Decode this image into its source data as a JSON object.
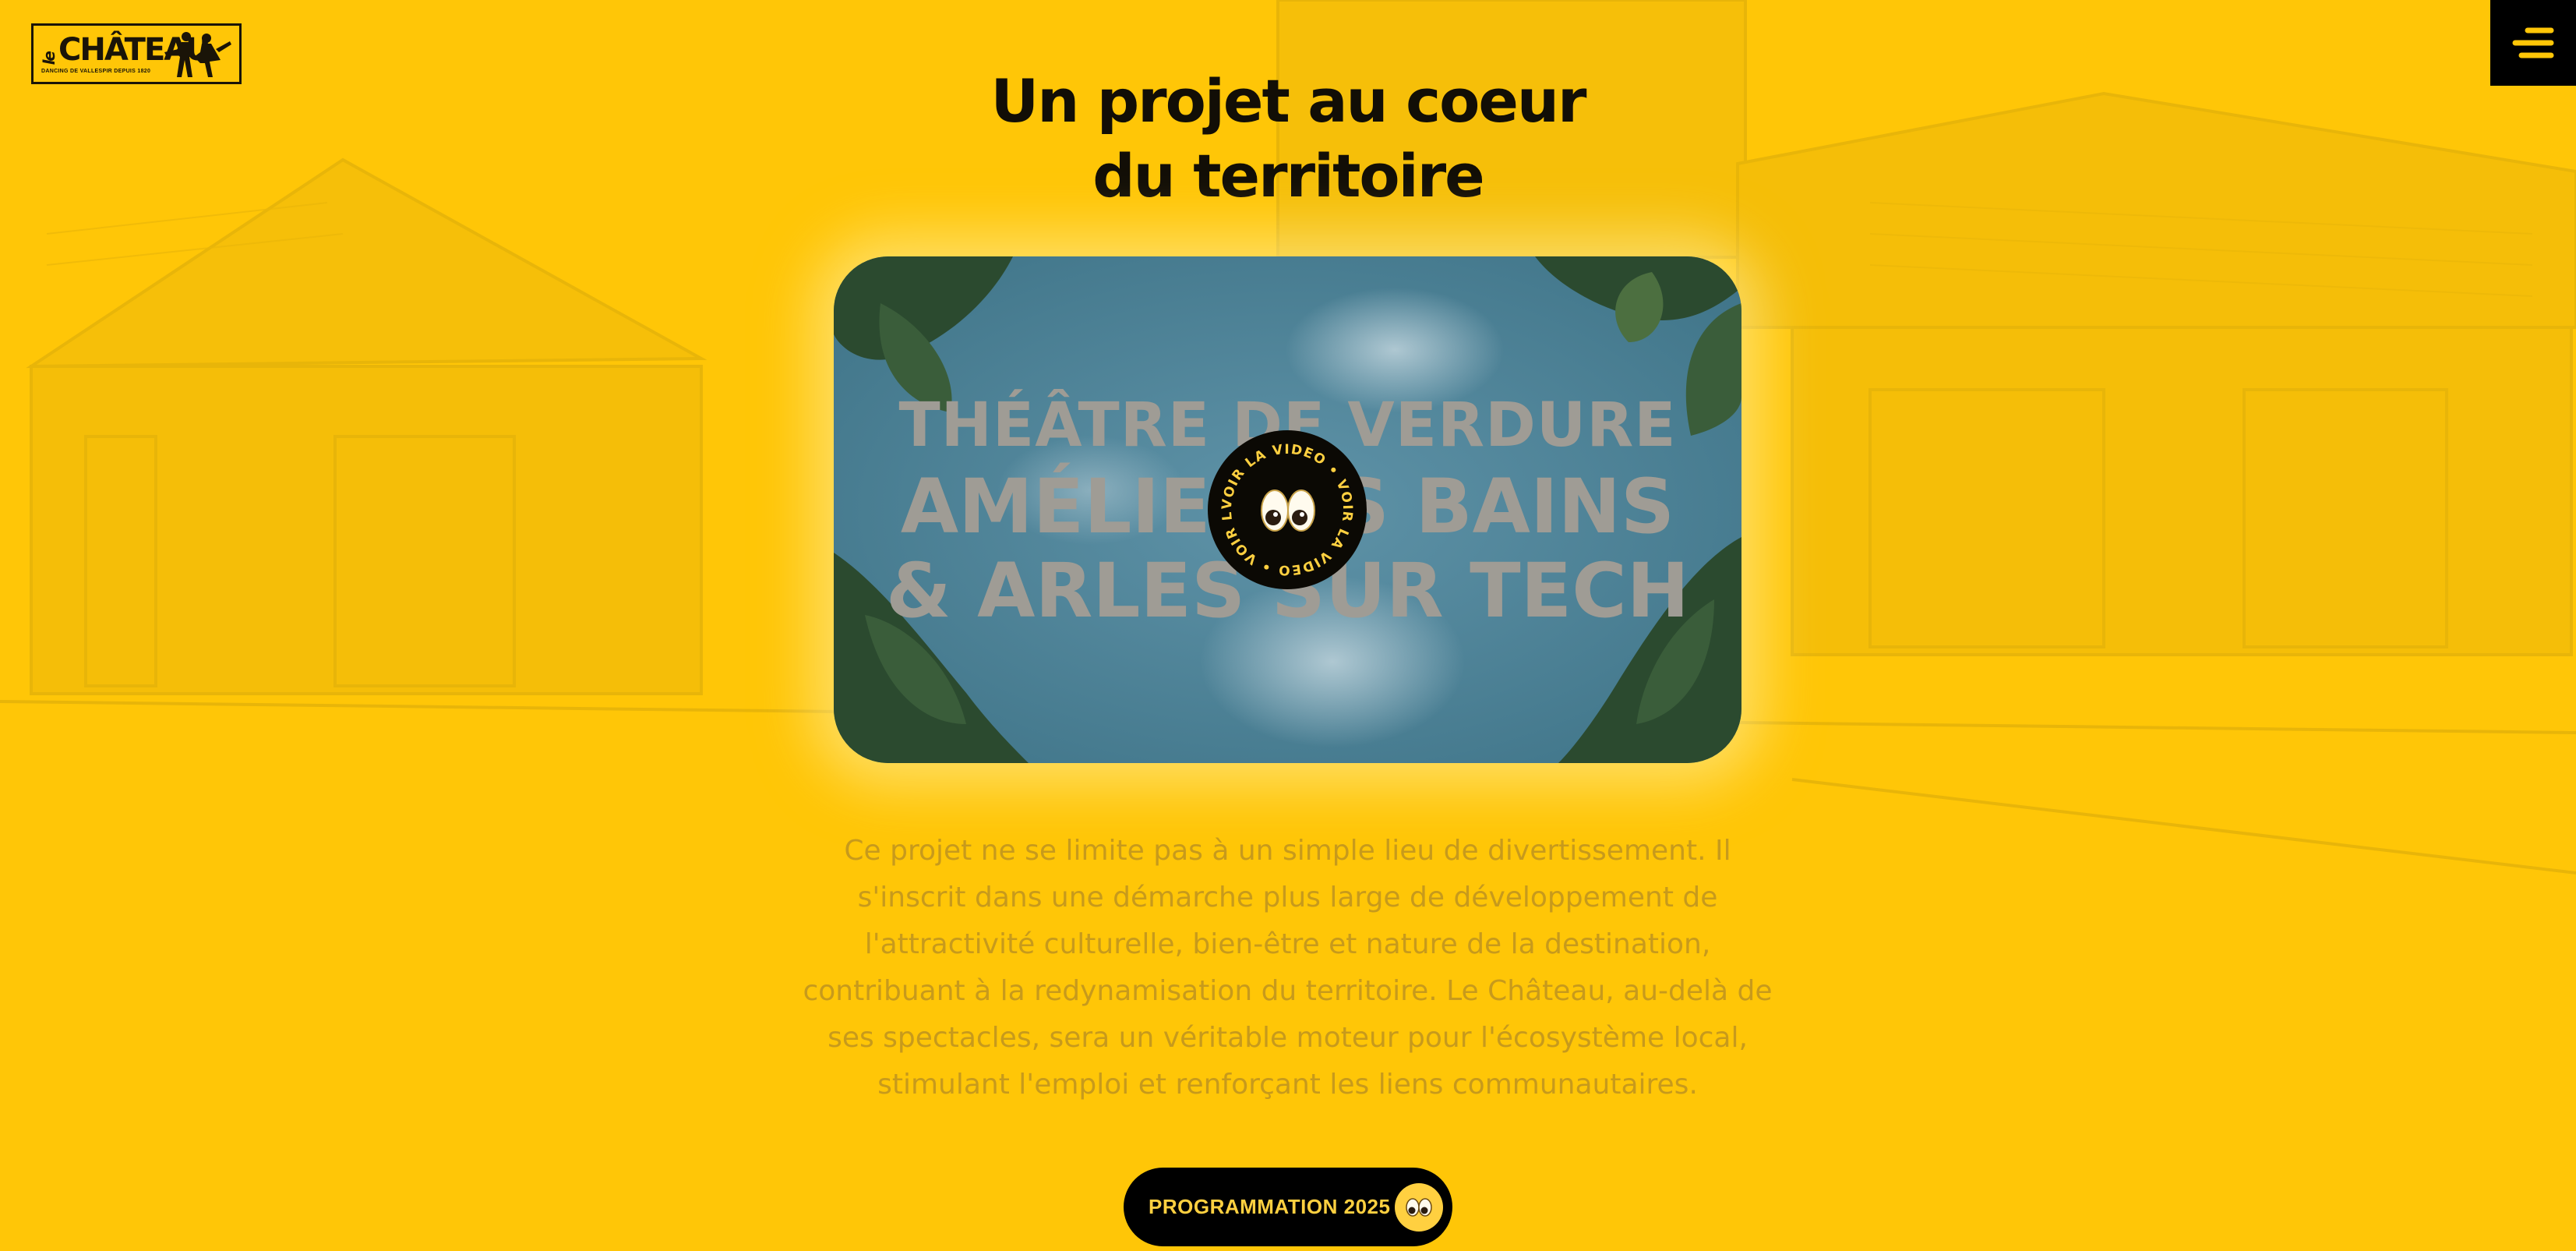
{
  "colors": {
    "background": "#ffc607",
    "dark": "#120e06",
    "accent": "#ffd040",
    "paragraph": "#c79a1c"
  },
  "logo": {
    "prefix": "le",
    "name": "CHÂTEAU",
    "tagline": "DANCING DE VALLESPIR DEPUIS 1820"
  },
  "menu": {
    "icon": "hamburger-menu-icon"
  },
  "heading": {
    "line1": "Un projet au coeur",
    "line2": "du territoire"
  },
  "video": {
    "title_line1": "THÉÂTRE DE VERDURE",
    "title_line2": "AMÉLIE LES BAINS",
    "title_line3": "& ARLES SUR TECH",
    "play_ring_text": "VOIR LA VIDEO • VOIR LA VIDEO • VOIR LA VIDEO • ",
    "play_icon": "eyes-icon"
  },
  "description": "Ce projet ne se limite pas à un simple lieu de divertissement. Il s'inscrit dans une démarche plus large de développement de l'attractivité culturelle, bien-être et nature de la destination, contribuant à la redynamisation du territoire. Le Château, au-delà de ses spectacles, sera un véritable moteur pour l'écosystème local, stimulant l'emploi et renforçant les liens communautaires.",
  "cta": {
    "label": "PROGRAMMATION 2025",
    "icon": "eyes-icon"
  }
}
